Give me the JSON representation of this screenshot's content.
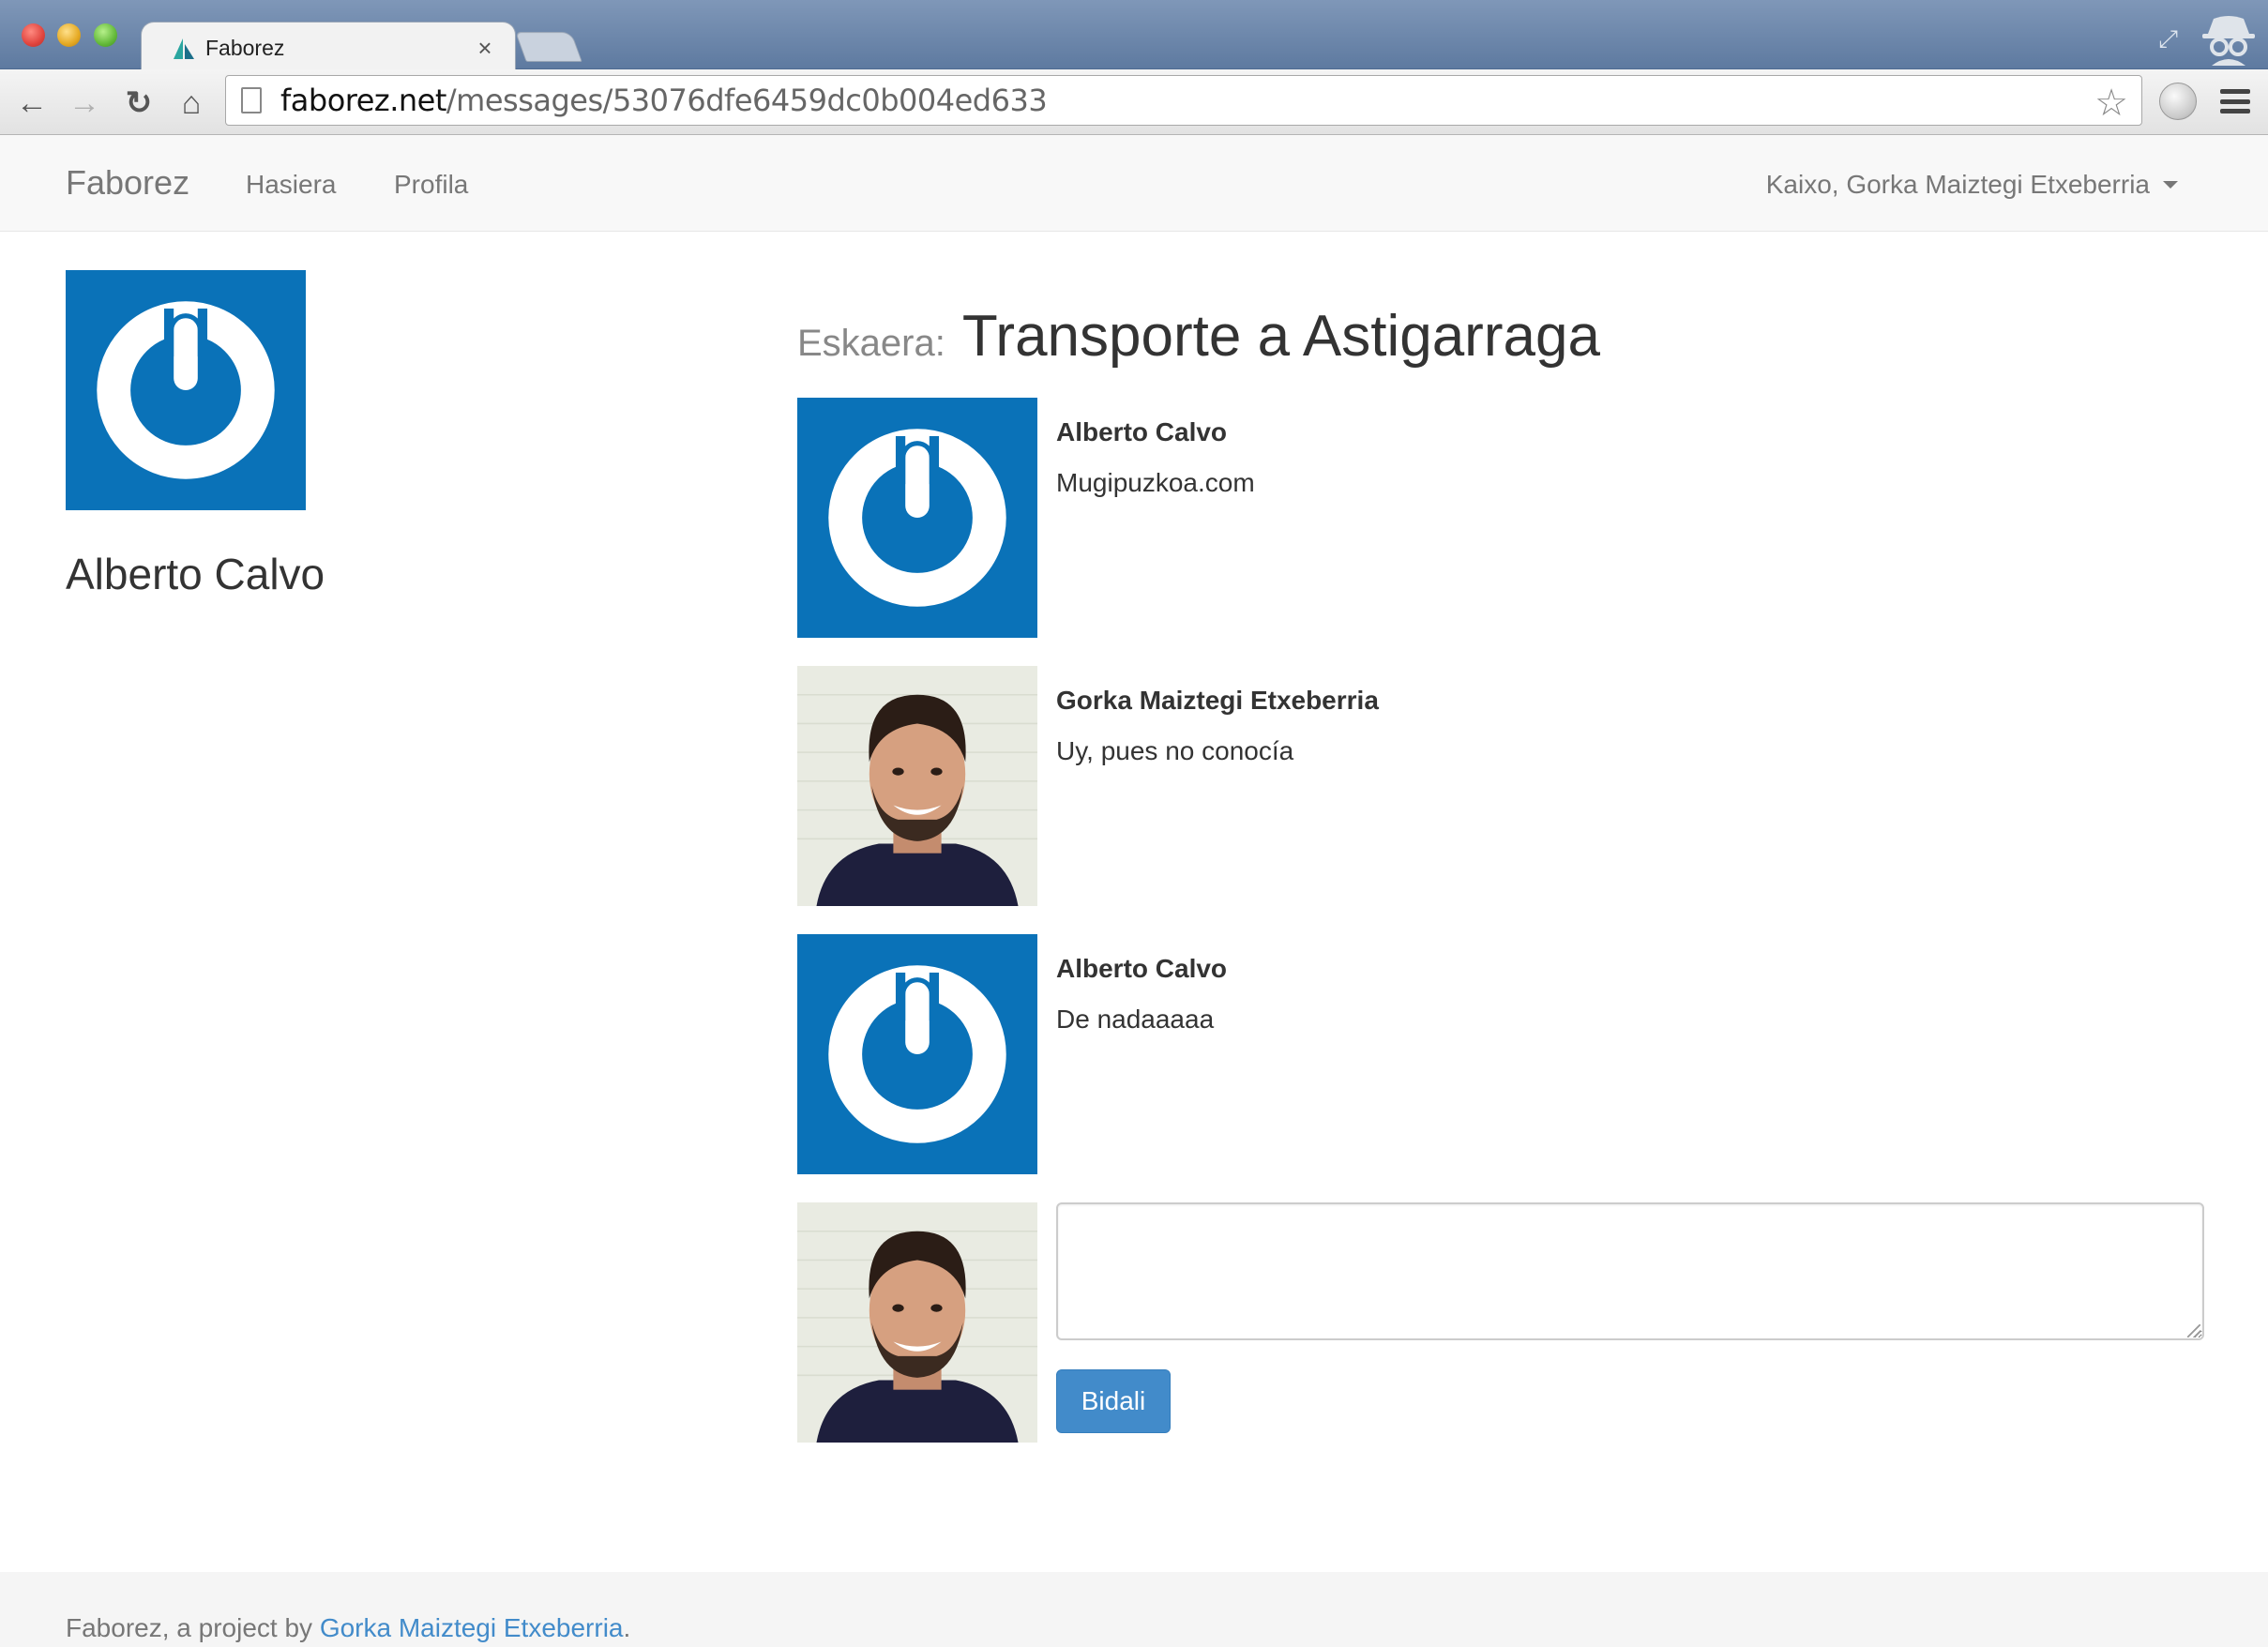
{
  "browser": {
    "tab_title": "Faborez",
    "url_host": "faborez.net",
    "url_path": "/messages/53076dfe6459dc0b004ed633"
  },
  "navbar": {
    "brand": "Faborez",
    "links": [
      "Hasiera",
      "Profila"
    ],
    "user_menu": "Kaixo, Gorka Maiztegi Etxeberria"
  },
  "profile": {
    "name": "Alberto Calvo",
    "avatar_icon": "gnome-power-logo-icon"
  },
  "request": {
    "label": "Eskaera:",
    "title": "Transporte a Astigarraga"
  },
  "messages": [
    {
      "author": "Alberto Calvo",
      "text": "Mugipuzkoa.com",
      "avatar": "gnome-power-logo-icon"
    },
    {
      "author": "Gorka Maiztegi Etxeberria",
      "text": "Uy, pues no conocía",
      "avatar": "user-photo"
    },
    {
      "author": "Alberto Calvo",
      "text": "De nadaaaaa",
      "avatar": "gnome-power-logo-icon"
    }
  ],
  "reply": {
    "value": "",
    "submit_label": "Bidali"
  },
  "footer": {
    "prefix": "Faborez, a project by ",
    "author_link": "Gorka Maiztegi Etxeberria",
    "suffix": "."
  },
  "colors": {
    "logo_blue": "#0a72b8",
    "primary_button": "#428bca",
    "navbar_bg": "#f8f8f8"
  }
}
